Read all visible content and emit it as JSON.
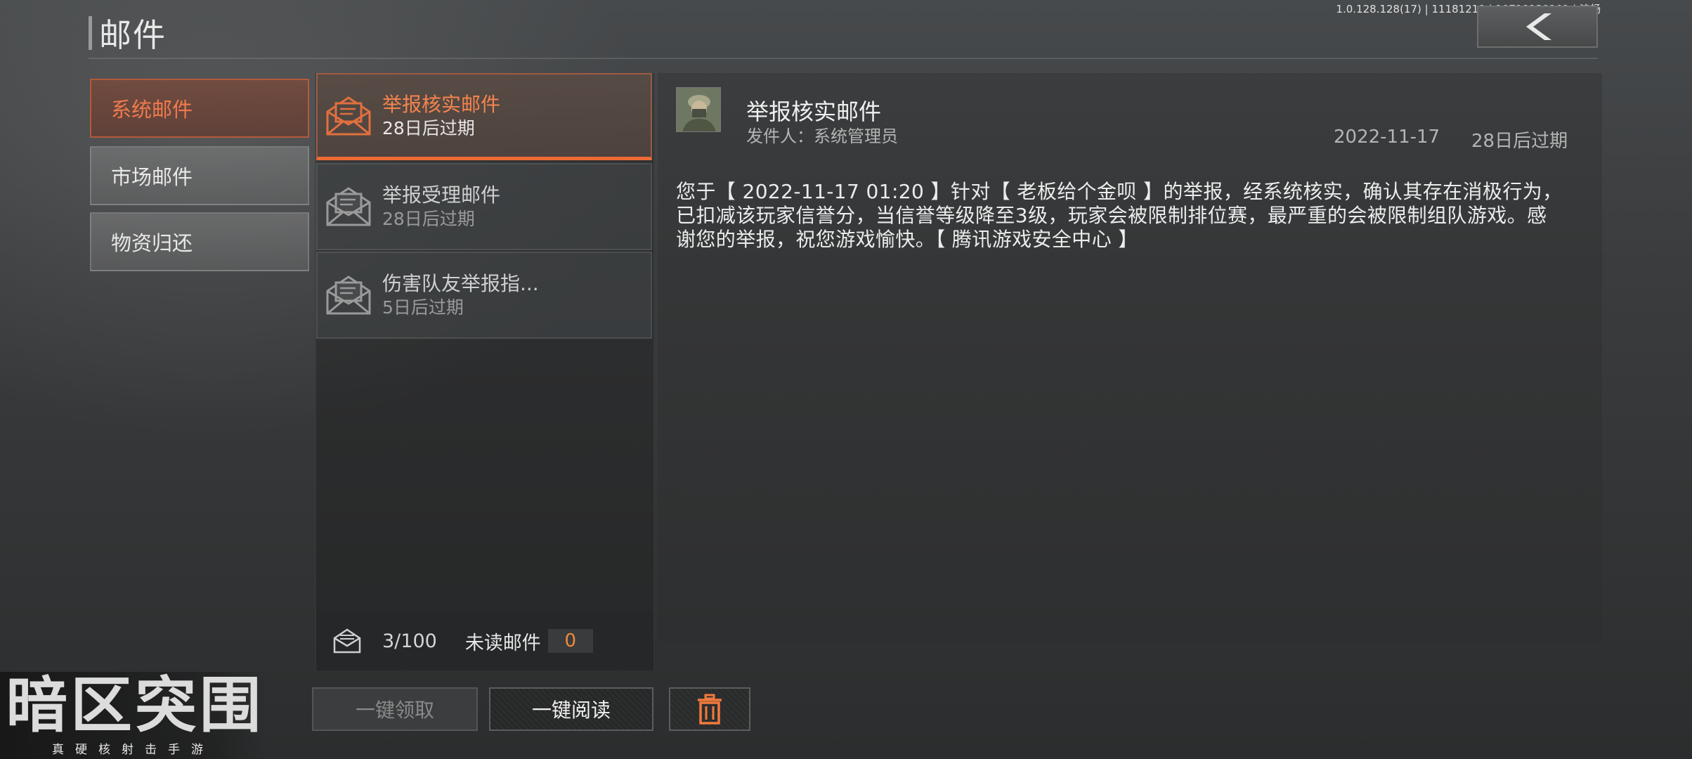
{
  "header": {
    "title": "邮件",
    "version": "1.0.128.128(17) | 11181219 | 10719139101 | 流畅",
    "back_icon": "chevron-left-icon"
  },
  "sidebar": {
    "items": [
      {
        "label": "系统邮件",
        "active": true
      },
      {
        "label": "市场邮件",
        "active": false
      },
      {
        "label": "物资归还",
        "active": false
      }
    ]
  },
  "mail_list": {
    "items": [
      {
        "subject": "举报核实邮件",
        "expire": "28日后过期",
        "active": true
      },
      {
        "subject": "举报受理邮件",
        "expire": "28日后过期",
        "active": false
      },
      {
        "subject": "伤害队友举报指...",
        "expire": "5日后过期",
        "active": false
      }
    ],
    "count": "3/100",
    "unread_label": "未读邮件",
    "unread_value": "0"
  },
  "actions": {
    "claim_all": "一键领取",
    "read_all": "一键阅读",
    "delete_icon": "trash-icon"
  },
  "detail": {
    "title": "举报核实邮件",
    "sender": "发件人：系统管理员",
    "date": "2022-11-17",
    "expire": "28日后过期",
    "body": "您于【 2022-11-17 01:20 】针对【 老板给个金呗 】的举报，经系统核实，确认其存在消极行为，已扣减该玩家信誉分，当信誉等级降至3级，玩家会被限制排位赛，最严重的会被限制组队游戏。感谢您的举报，祝您游戏愉快。【 腾讯游戏安全中心 】"
  },
  "logo": {
    "title": "暗区突围",
    "tagline": "真硬核射击手游"
  },
  "colors": {
    "accent": "#f07a4c",
    "unread": "#f08a3c"
  }
}
